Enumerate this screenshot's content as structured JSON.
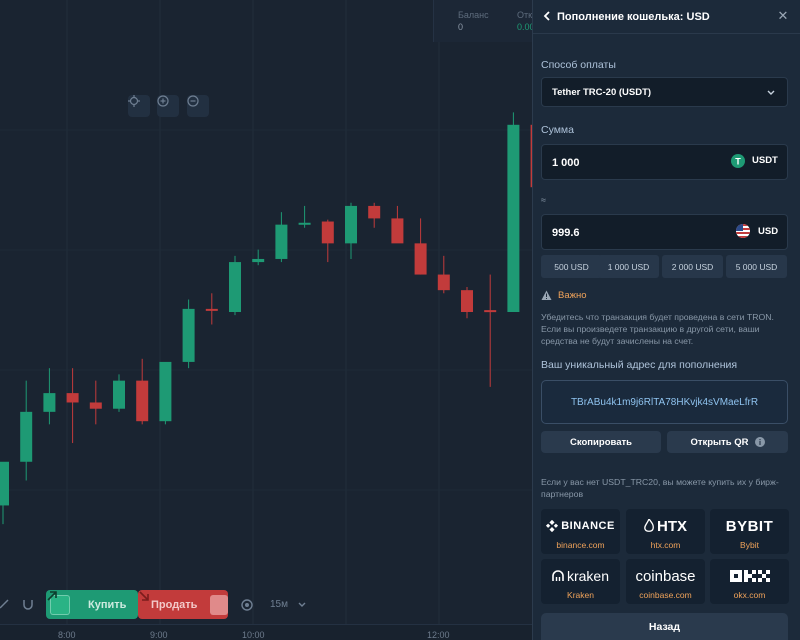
{
  "top_stats": {
    "balance_label": "Баланс",
    "balance_value": "0",
    "second_label": "Отк",
    "second_value": "0.00"
  },
  "bottom_bar": {
    "buy_label": "Купить",
    "sell_label": "Продать",
    "interval": "15м"
  },
  "time_axis": [
    "8:00",
    "9:00",
    "10:00",
    "12:00"
  ],
  "panel": {
    "title": "Пополнение кошелька: USD",
    "payment_method_label": "Способ оплаты",
    "payment_method_value": "Tether TRC-20 (USDT)",
    "amount_label": "Сумма",
    "amount_value": "1 000",
    "amount_currency": "USDT",
    "approx_label": "≈",
    "converted_value": "999.6",
    "converted_currency": "USD",
    "quick_amounts": [
      "500 USD",
      "1 000 USD",
      "2 000 USD",
      "5 000 USD"
    ],
    "warning_label": "Важно",
    "warning_text": "Убедитесь что транзакция будет проведена в сети TRON. Если вы произведете транзакцию в другой сети, ваши средства не будут зачислены на счет.",
    "address_label": "Ваш уникальный адрес для пополнения",
    "address_value": "TBrABu4k1m9j6RlTA78HKvjk4sVMaeLfrR",
    "copy_label": "Скопировать",
    "qr_label": "Открыть QR",
    "exchanges_text": "Если у вас нет USDT_TRC20, вы можете купить их у бирж-партнеров",
    "exchanges": [
      {
        "logo": "BINANCE",
        "name": "binance.com"
      },
      {
        "logo": "HTX",
        "name": "htx.com"
      },
      {
        "logo": "BYBIT",
        "name": "Bybit"
      },
      {
        "logo": "kraken",
        "name": "Kraken"
      },
      {
        "logo": "coinbase",
        "name": "coinbase.com"
      },
      {
        "logo": "OKX",
        "name": "okx.com"
      }
    ],
    "back_label": "Назад"
  },
  "colors": {
    "up": "#1e9a74",
    "down": "#c23b3b",
    "accent_orange": "#f0a35a",
    "panel_bg": "#1c2a3a"
  },
  "chart_data": {
    "type": "candlestick",
    "candles": [
      {
        "o": 0.81,
        "h": 0.79,
        "l": 0.84,
        "c": 0.74
      },
      {
        "o": 0.74,
        "h": 0.61,
        "l": 0.77,
        "c": 0.66
      },
      {
        "o": 0.66,
        "h": 0.59,
        "l": 0.68,
        "c": 0.63
      },
      {
        "o": 0.63,
        "h": 0.59,
        "l": 0.71,
        "c": 0.645
      },
      {
        "o": 0.645,
        "h": 0.61,
        "l": 0.68,
        "c": 0.655
      },
      {
        "o": 0.655,
        "h": 0.6,
        "l": 0.66,
        "c": 0.61
      },
      {
        "o": 0.61,
        "h": 0.575,
        "l": 0.68,
        "c": 0.675
      },
      {
        "o": 0.675,
        "h": 0.6,
        "l": 0.68,
        "c": 0.58
      },
      {
        "o": 0.58,
        "h": 0.48,
        "l": 0.59,
        "c": 0.495
      },
      {
        "o": 0.495,
        "h": 0.47,
        "l": 0.52,
        "c": 0.495
      },
      {
        "o": 0.5,
        "h": 0.41,
        "l": 0.505,
        "c": 0.42
      },
      {
        "o": 0.42,
        "h": 0.4,
        "l": 0.425,
        "c": 0.415
      },
      {
        "o": 0.415,
        "h": 0.34,
        "l": 0.42,
        "c": 0.36
      },
      {
        "o": 0.36,
        "h": 0.33,
        "l": 0.365,
        "c": 0.357
      },
      {
        "o": 0.355,
        "h": 0.352,
        "l": 0.42,
        "c": 0.39
      },
      {
        "o": 0.39,
        "h": 0.325,
        "l": 0.415,
        "c": 0.33
      },
      {
        "o": 0.33,
        "h": 0.325,
        "l": 0.365,
        "c": 0.35
      },
      {
        "o": 0.35,
        "h": 0.33,
        "l": 0.36,
        "c": 0.39
      },
      {
        "o": 0.39,
        "h": 0.35,
        "l": 0.44,
        "c": 0.44
      },
      {
        "o": 0.44,
        "h": 0.41,
        "l": 0.47,
        "c": 0.465
      },
      {
        "o": 0.465,
        "h": 0.46,
        "l": 0.51,
        "c": 0.5
      },
      {
        "o": 0.497,
        "h": 0.44,
        "l": 0.62,
        "c": 0.497
      },
      {
        "o": 0.5,
        "h": 0.18,
        "l": 0.5,
        "c": 0.2
      },
      {
        "o": 0.2,
        "h": 0.17,
        "l": 0.3,
        "c": 0.3
      }
    ]
  }
}
